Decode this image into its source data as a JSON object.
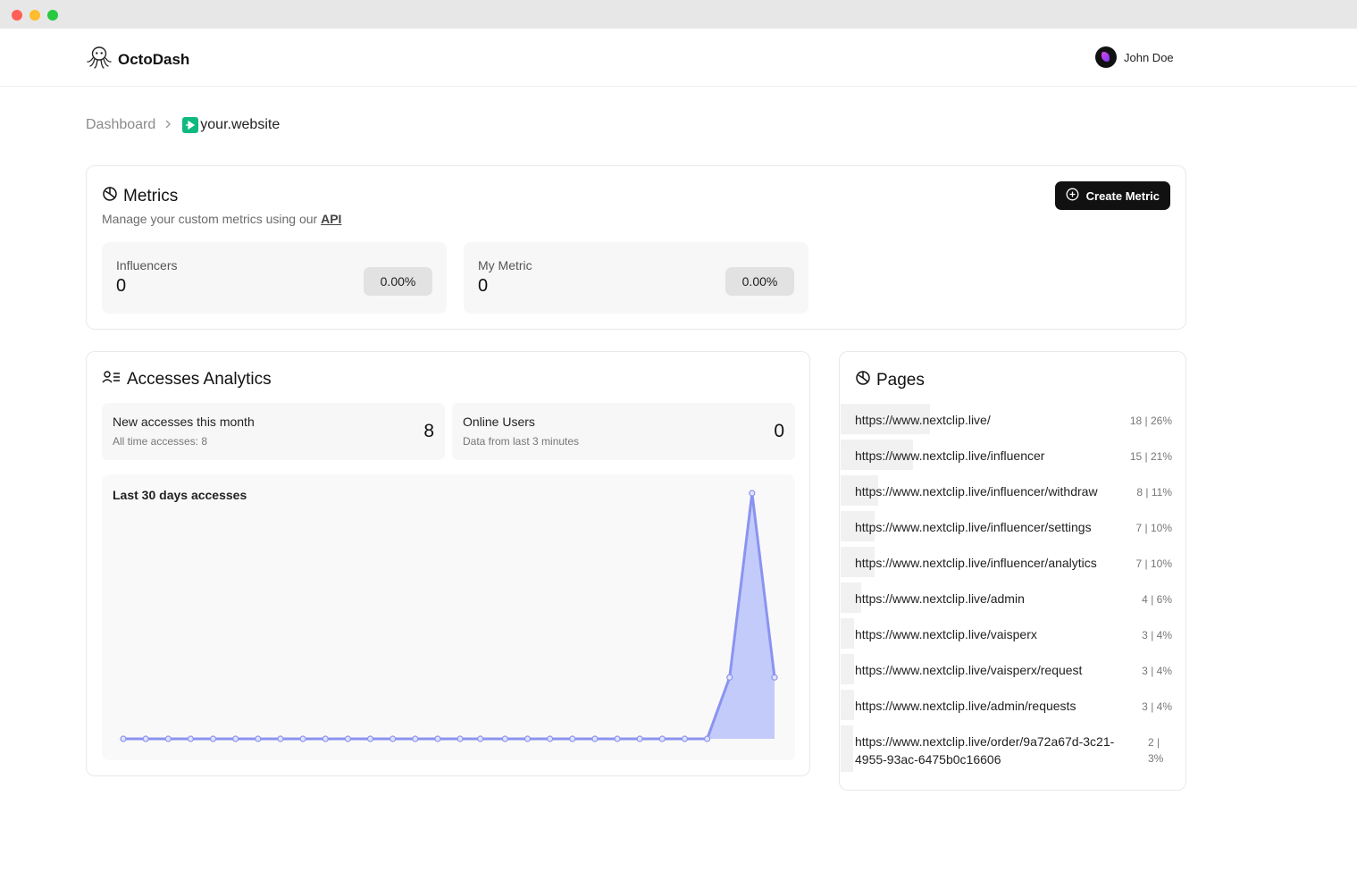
{
  "app": {
    "brand": "OctoDash",
    "user_name": "John Doe"
  },
  "breadcrumb": {
    "root": "Dashboard",
    "site": "your.website"
  },
  "metrics": {
    "title": "Metrics",
    "subtitle_prefix": "Manage your custom metrics using our",
    "api_link": "API",
    "create_label": "Create Metric",
    "items": [
      {
        "name": "Influencers",
        "value": "0",
        "percent": "0.00%"
      },
      {
        "name": "My Metric",
        "value": "0",
        "percent": "0.00%"
      }
    ]
  },
  "analytics": {
    "title": "Accesses Analytics",
    "new_accesses": {
      "label": "New accesses this month",
      "sub": "All time accesses: 8",
      "value": "8"
    },
    "online_users": {
      "label": "Online Users",
      "sub": "Data from last 3 minutes",
      "value": "0"
    },
    "chart_title": "Last 30 days accesses"
  },
  "chart_data": {
    "type": "area",
    "title": "Last 30 days accesses",
    "x": [
      1,
      2,
      3,
      4,
      5,
      6,
      7,
      8,
      9,
      10,
      11,
      12,
      13,
      14,
      15,
      16,
      16.9,
      18,
      19,
      20,
      21,
      22,
      23,
      24,
      25,
      26,
      27,
      28,
      29,
      30
    ],
    "values": [
      0,
      0,
      0,
      0,
      0,
      0,
      0,
      0,
      0,
      0,
      0,
      0,
      0,
      0,
      0,
      0,
      0,
      0,
      0,
      0,
      0,
      0,
      0,
      0,
      0,
      0,
      0,
      2,
      8,
      2
    ],
    "ylim": [
      0,
      8
    ],
    "grid": false,
    "color": "#8b93f0",
    "fill": "#c3cbfb"
  },
  "pages": {
    "title": "Pages",
    "items": [
      {
        "url": "https://www.nextclip.live/",
        "count": "18",
        "percent": "26%",
        "share": 26
      },
      {
        "url": "https://www.nextclip.live/influencer",
        "count": "15",
        "percent": "21%",
        "share": 21
      },
      {
        "url": "https://www.nextclip.live/influencer/withdraw",
        "count": "8",
        "percent": "11%",
        "share": 11
      },
      {
        "url": "https://www.nextclip.live/influencer/settings",
        "count": "7",
        "percent": "10%",
        "share": 10
      },
      {
        "url": "https://www.nextclip.live/influencer/analytics",
        "count": "7",
        "percent": "10%",
        "share": 10
      },
      {
        "url": "https://www.nextclip.live/admin",
        "count": "4",
        "percent": "6%",
        "share": 6
      },
      {
        "url": "https://www.nextclip.live/vaisperx",
        "count": "3",
        "percent": "4%",
        "share": 4
      },
      {
        "url": "https://www.nextclip.live/vaisperx/request",
        "count": "3",
        "percent": "4%",
        "share": 4
      },
      {
        "url": "https://www.nextclip.live/admin/requests",
        "count": "3",
        "percent": "4%",
        "share": 4
      },
      {
        "url": "https://www.nextclip.live/order/9a72a67d-3c21-4955-93ac-6475b0c16606",
        "count": "2",
        "percent": "3%",
        "share": 3
      }
    ]
  }
}
